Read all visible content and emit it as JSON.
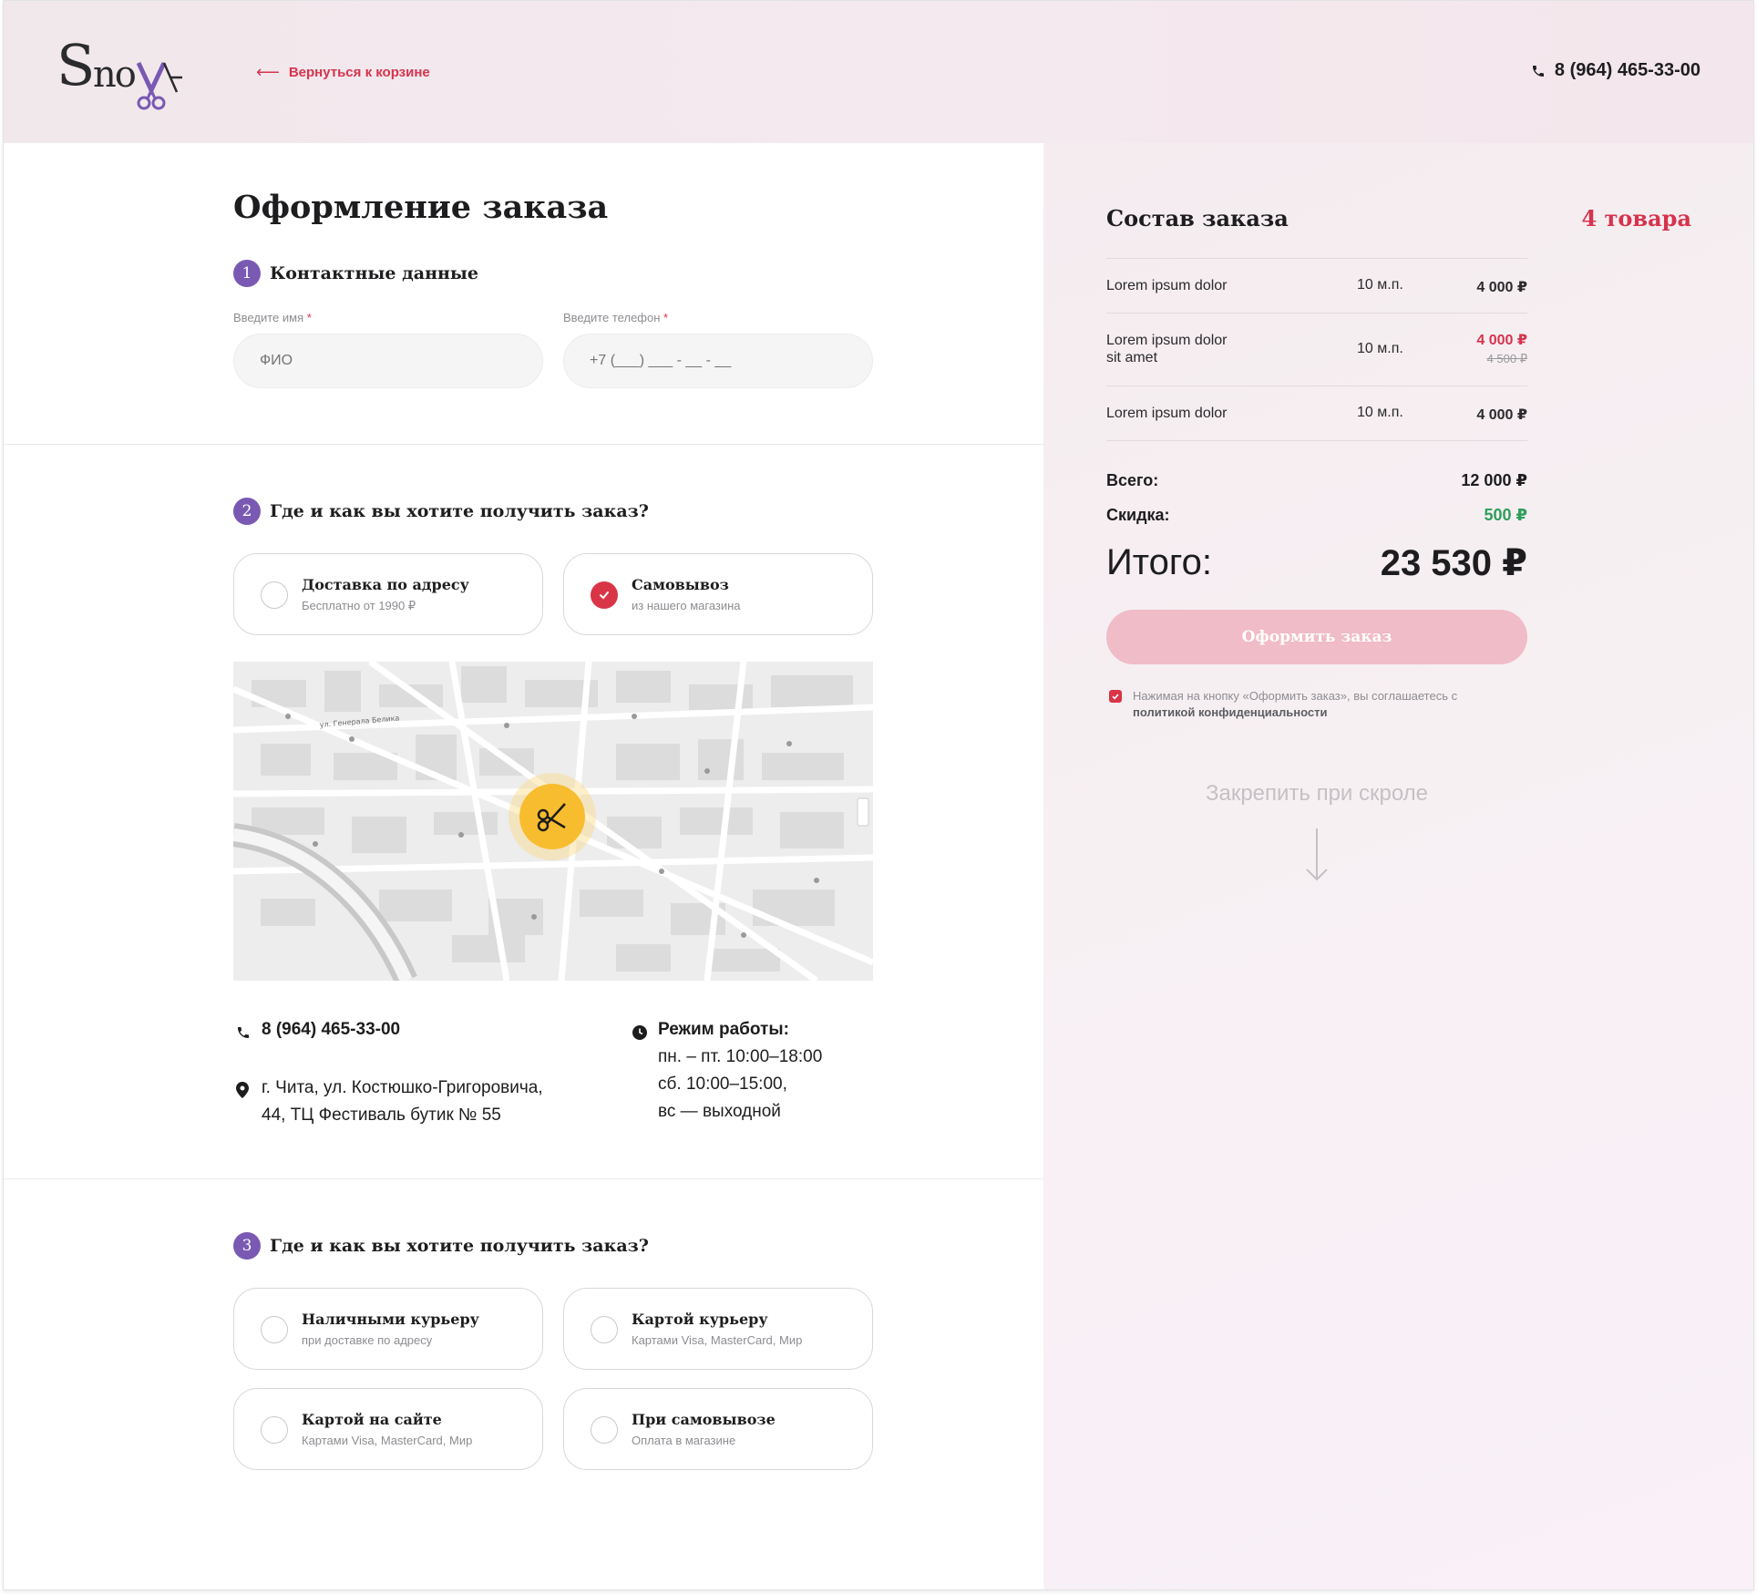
{
  "brand": {
    "logo_text": "SnoYa",
    "accent": "#d6334e",
    "purple": "#7a59b3"
  },
  "header": {
    "back_label": "Вернуться к корзине",
    "phone": "8 (964) 465-33-00"
  },
  "checkout": {
    "title": "Оформление заказа",
    "step1": {
      "number": "1",
      "title": "Контактные данные",
      "name_label": "Введите имя",
      "name_placeholder": "ФИО",
      "phone_label": "Введите телефон",
      "phone_placeholder": "+7 (___) ___ - __ - __",
      "required_mark": "*"
    },
    "step2": {
      "number": "2",
      "title": "Где и как вы хотите получить заказ?",
      "options": [
        {
          "title": "Доставка по адресу",
          "subtitle": "Бесплатно от 1990 ₽",
          "selected": false
        },
        {
          "title": "Самовывоз",
          "subtitle": "из нашего магазина",
          "selected": true
        }
      ],
      "map": {
        "label_street": "ул. Генерала Белика",
        "pin_icon": "scissors-icon"
      },
      "store": {
        "phone": "8 (964) 465-33-00",
        "address_line1": "г. Чита, ул. Костюшко-Григоровича,",
        "address_line2": "44, ТЦ Фестиваль бутик № 55",
        "hours_title": "Режим работы:",
        "hours_line1": "пн. – пт. 10:00–18:00",
        "hours_line2": "сб. 10:00–15:00,",
        "hours_line3": "вс — выходной"
      }
    },
    "step3": {
      "number": "3",
      "title": "Где и как вы хотите получить заказ?",
      "options": [
        {
          "title": "Наличными курьеру",
          "subtitle": "при доставке по адресу",
          "selected": false
        },
        {
          "title": "Картой курьеру",
          "subtitle": "Картами Visa, MasterCard, Мир",
          "selected": false
        },
        {
          "title": "Картой на сайте",
          "subtitle": "Картами Visa, MasterCard, Мир",
          "selected": false
        },
        {
          "title": "При самовывозе",
          "subtitle": "Оплата в магазине",
          "selected": false
        }
      ]
    }
  },
  "order": {
    "title": "Состав заказа",
    "count": "4 товара",
    "items": [
      {
        "name": "Lorem ipsum dolor",
        "name2": "",
        "qty": "10 м.п.",
        "price": "4 000 ₽",
        "old_price": ""
      },
      {
        "name": "Lorem ipsum dolor",
        "name2": "sit amet",
        "qty": "10 м.п.",
        "price": "4 000 ₽",
        "old_price": "4 500 ₽"
      },
      {
        "name": "Lorem ipsum dolor",
        "name2": "",
        "qty": "10 м.п.",
        "price": "4 000 ₽",
        "old_price": ""
      }
    ],
    "subtotal_label": "Всего:",
    "subtotal_value": "12 000 ₽",
    "discount_label": "Скидка:",
    "discount_value": "500 ₽",
    "total_label": "Итого:",
    "total_value": "23 530 ₽",
    "submit_label": "Оформить заказ",
    "consent_text": "Нажимая на кнопку «Оформить заказ», вы соглашаетесь с",
    "consent_link": "политикой конфиденциальности",
    "pin_text": "Закрепить при скроле"
  }
}
